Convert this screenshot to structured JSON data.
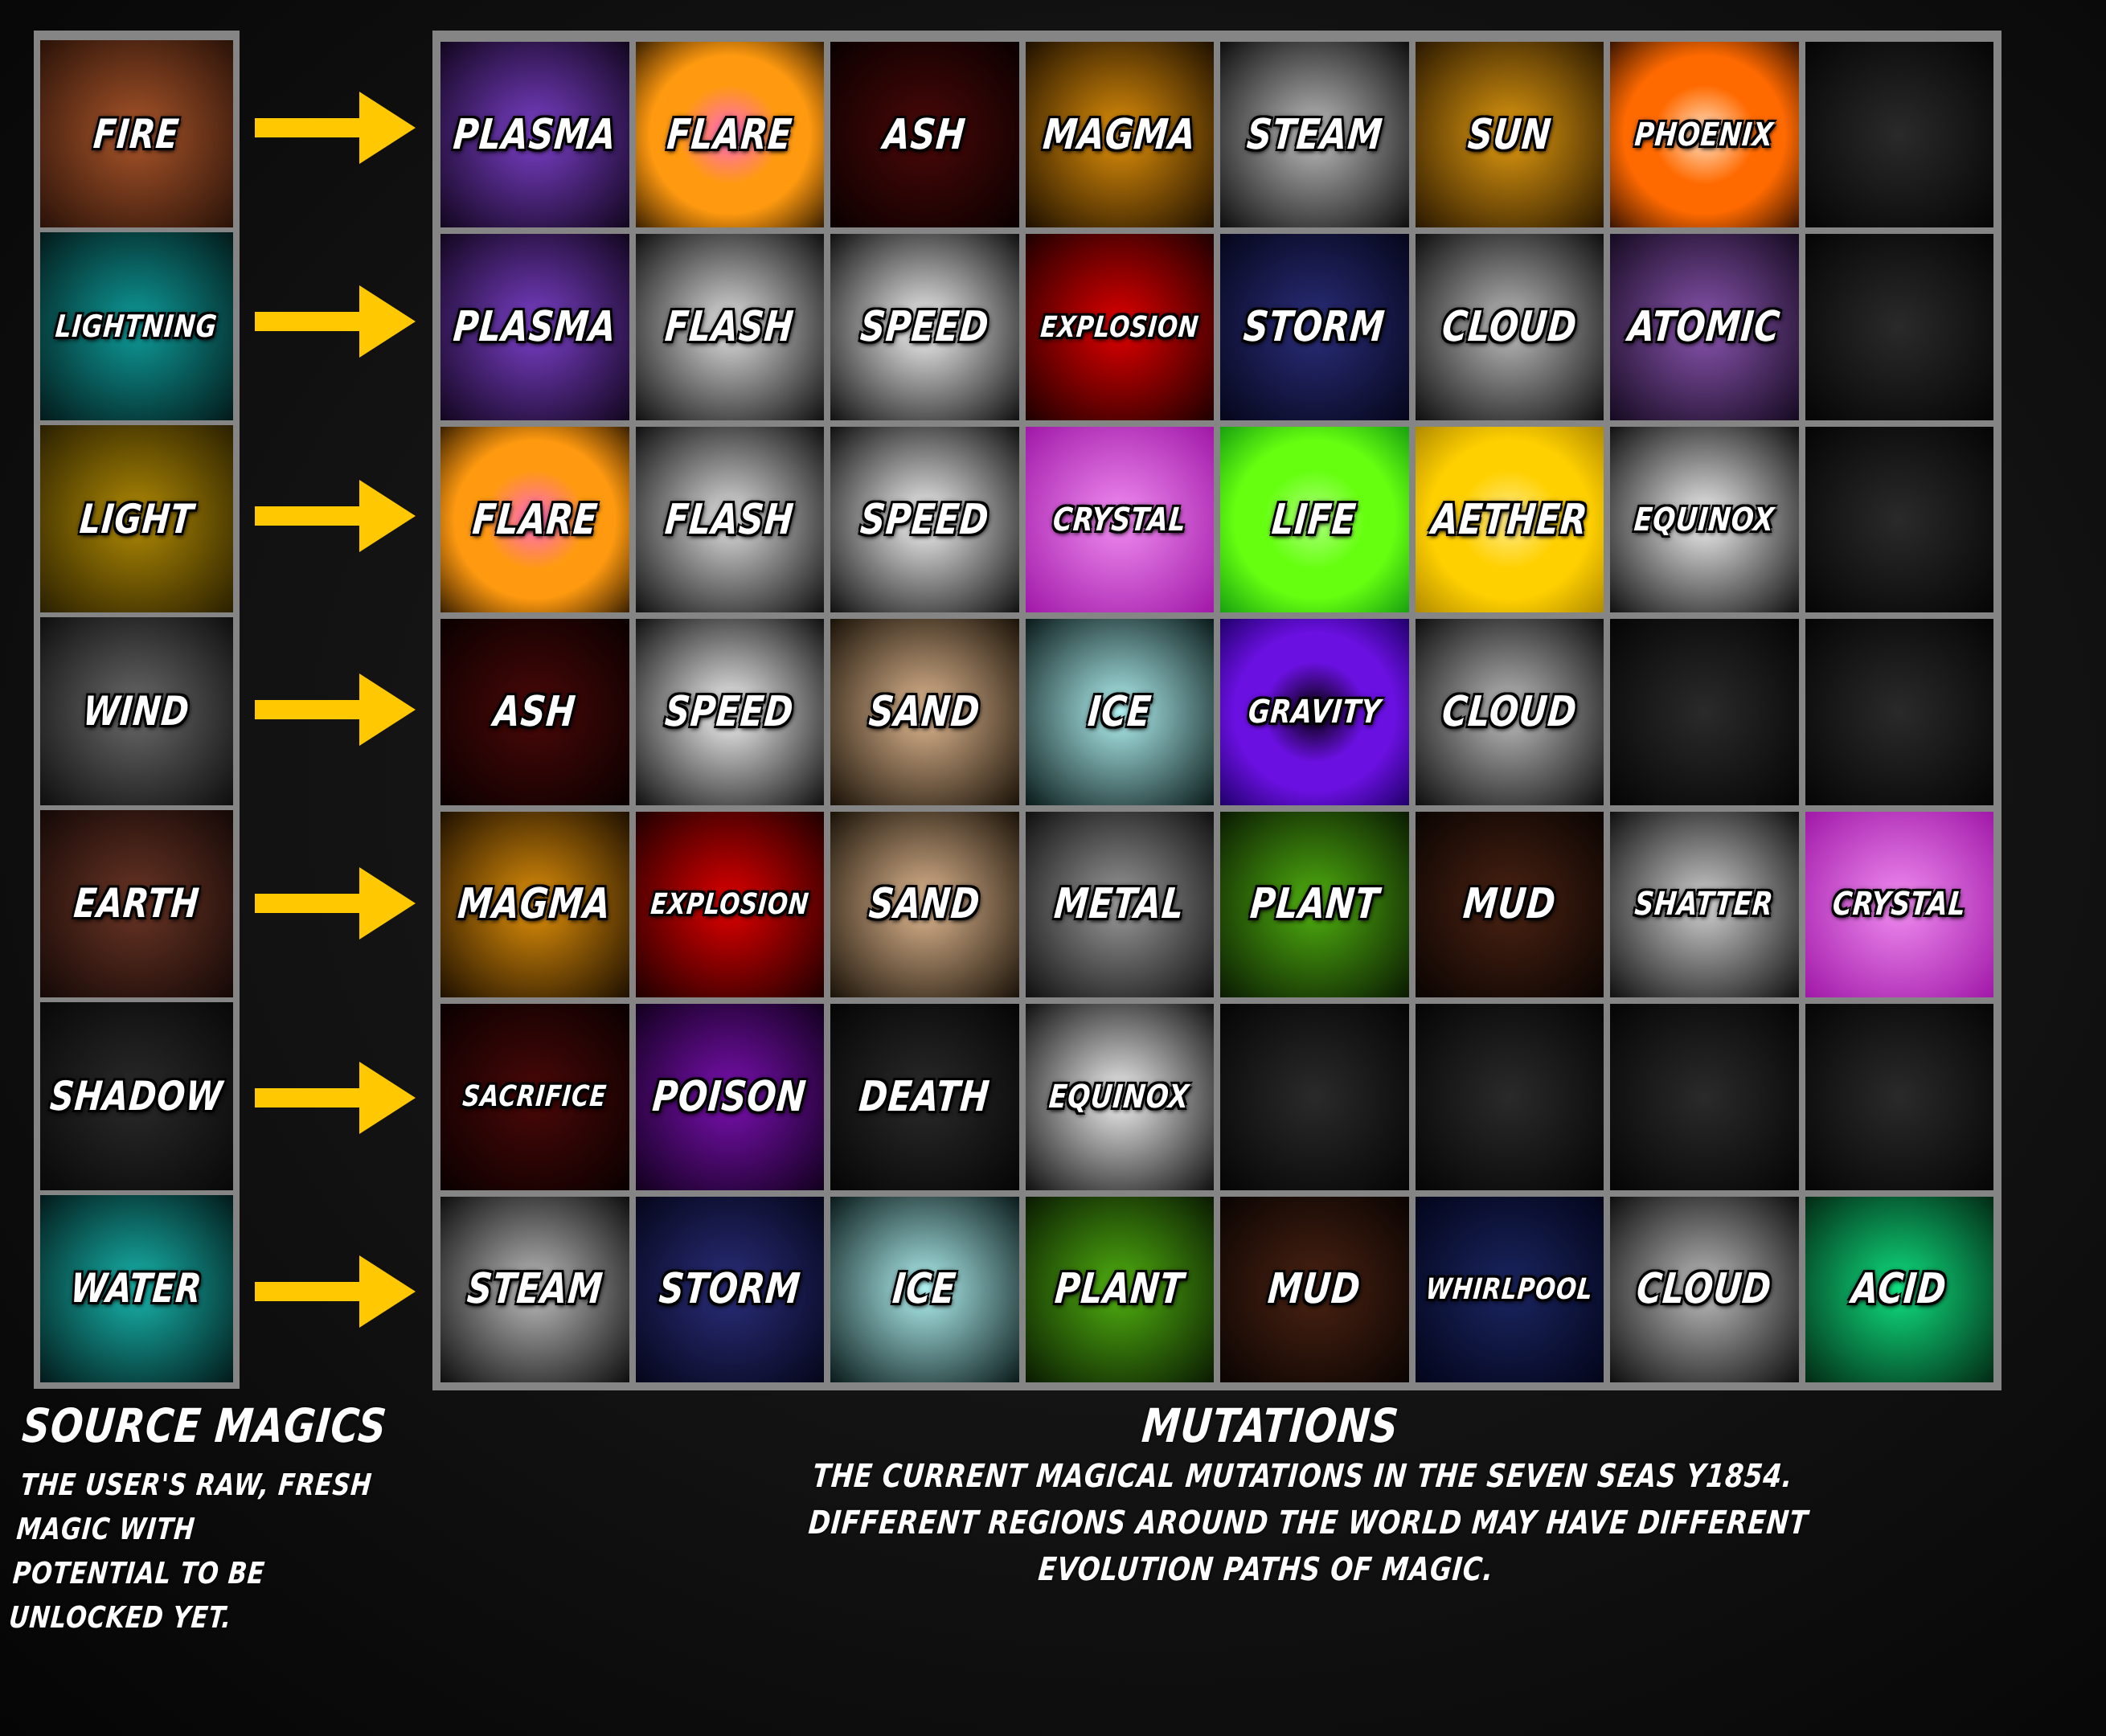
{
  "source_panel": {
    "title": "SOURCE MAGICS",
    "description": "THE USER'S RAW, FRESH MAGIC WITH POTENTIAL TO BE UNLOCKED YET.",
    "description_lines": [
      "THE USER'S RAW, FRESH",
      "MAGIC WITH",
      "POTENTIAL TO BE",
      "UNLOCKED YET."
    ],
    "sources": [
      {
        "label": "FIRE",
        "color": "#a9552a",
        "edge": "#2a1208"
      },
      {
        "label": "LIGHTNING",
        "color": "#0e9c9a",
        "edge": "#031a1a"
      },
      {
        "label": "LIGHT",
        "color": "#b08a05",
        "edge": "#2a2000"
      },
      {
        "label": "WIND",
        "color": "#6a6a6a",
        "edge": "#0e0e0e"
      },
      {
        "label": "EARTH",
        "color": "#6a3525",
        "edge": "#140806"
      },
      {
        "label": "SHADOW",
        "color": "#2a2a2a",
        "edge": "#080808"
      },
      {
        "label": "WATER",
        "color": "#18b5ac",
        "edge": "#021a1a"
      }
    ]
  },
  "arrow_color": "#ffc800",
  "mutation_panel": {
    "title": "MUTATIONS",
    "description_lines": [
      "THE CURRENT MAGICAL MUTATIONS IN THE SEVEN SEAS Y1854.",
      "DIFFERENT REGIONS AROUND THE WORLD MAY HAVE DIFFERENT",
      "EVOLUTION PATHS OF MAGIC."
    ],
    "rows": [
      {
        "source": "FIRE",
        "cells": [
          {
            "label": "PLASMA",
            "color": "#7a3fc8",
            "edge": "#12061e"
          },
          {
            "label": "FLARE",
            "color": "#ff66cc",
            "mid": "#ff9a10",
            "edge": "#3a2000"
          },
          {
            "label": "ASH",
            "color": "#4a0808",
            "edge": "#0a0000"
          },
          {
            "label": "MAGMA",
            "color": "#e0900a",
            "edge": "#1e1000"
          },
          {
            "label": "STEAM",
            "color": "#bdbdbd",
            "edge": "#0e0e0e"
          },
          {
            "label": "SUN",
            "color": "#e09a10",
            "edge": "#2a1800"
          },
          {
            "label": "PHOENIX",
            "color": "#ffe6cc",
            "mid": "#ff6a00",
            "edge": "#3a1400"
          },
          {
            "label": "",
            "color": "#2a2a2a",
            "edge": "#050505"
          }
        ]
      },
      {
        "source": "LIGHTNING",
        "cells": [
          {
            "label": "PLASMA",
            "color": "#7a3fc8",
            "edge": "#12061e"
          },
          {
            "label": "FLASH",
            "color": "#e0e0e0",
            "edge": "#101010"
          },
          {
            "label": "SPEED",
            "color": "#f4f4f4",
            "edge": "#101010"
          },
          {
            "label": "EXPLOSION",
            "color": "#e00000",
            "edge": "#1e0000"
          },
          {
            "label": "STORM",
            "color": "#2a2d7a",
            "edge": "#05061a"
          },
          {
            "label": "CLOUD",
            "color": "#bdbdbd",
            "edge": "#0e0e0e"
          },
          {
            "label": "ATOMIC",
            "color": "#8a55b0",
            "edge": "#150a20"
          },
          {
            "label": "",
            "color": "#2a2a2a",
            "edge": "#050505"
          }
        ]
      },
      {
        "source": "LIGHT",
        "cells": [
          {
            "label": "FLARE",
            "color": "#ff66cc",
            "mid": "#ff9a10",
            "edge": "#3a2000"
          },
          {
            "label": "FLASH",
            "color": "#e0e0e0",
            "edge": "#101010"
          },
          {
            "label": "SPEED",
            "color": "#f4f4f4",
            "edge": "#101010"
          },
          {
            "label": "CRYSTAL",
            "color": "#f08cf0",
            "edge": "#a018a8"
          },
          {
            "label": "LIFE",
            "color": "#b0ff80",
            "mid": "#66ff10",
            "edge": "#18a010"
          },
          {
            "label": "AETHER",
            "color": "#ffec90",
            "mid": "#ffd000",
            "edge": "#b08a00"
          },
          {
            "label": "EQUINOX",
            "color": "#f0f0f0",
            "edge": "#101010"
          },
          {
            "label": "",
            "color": "#2a2a2a",
            "edge": "#050505"
          }
        ]
      },
      {
        "source": "WIND",
        "cells": [
          {
            "label": "ASH",
            "color": "#4a0808",
            "edge": "#0a0000"
          },
          {
            "label": "SPEED",
            "color": "#f4f4f4",
            "edge": "#101010"
          },
          {
            "label": "SAND",
            "color": "#e0b890",
            "edge": "#1a1208"
          },
          {
            "label": "ICE",
            "color": "#b0f0f0",
            "edge": "#0a1a1a"
          },
          {
            "label": "GRAVITY",
            "color": "#000000",
            "mid": "#6a10e0",
            "edge": "#20006a"
          },
          {
            "label": "CLOUD",
            "color": "#bdbdbd",
            "edge": "#0e0e0e"
          },
          {
            "label": "",
            "color": "#2a2a2a",
            "edge": "#050505"
          },
          {
            "label": "",
            "color": "#2a2a2a",
            "edge": "#050505"
          }
        ]
      },
      {
        "source": "EARTH",
        "cells": [
          {
            "label": "MAGMA",
            "color": "#e0900a",
            "edge": "#1e1000"
          },
          {
            "label": "EXPLOSION",
            "color": "#e00000",
            "edge": "#1e0000"
          },
          {
            "label": "SAND",
            "color": "#e0b890",
            "edge": "#1a1208"
          },
          {
            "label": "METAL",
            "color": "#9a9a9a",
            "edge": "#101010"
          },
          {
            "label": "PLANT",
            "color": "#50b010",
            "edge": "#0a1a02"
          },
          {
            "label": "MUD",
            "color": "#4a2212",
            "edge": "#0a0402"
          },
          {
            "label": "SHATTER",
            "color": "#d0d0d0",
            "edge": "#101010"
          },
          {
            "label": "CRYSTAL",
            "color": "#f08cf0",
            "edge": "#a018a8"
          }
        ]
      },
      {
        "source": "SHADOW",
        "cells": [
          {
            "label": "SACRIFICE",
            "color": "#4a0808",
            "edge": "#0a0000"
          },
          {
            "label": "POISON",
            "color": "#7a10b0",
            "edge": "#12001e"
          },
          {
            "label": "DEATH",
            "color": "#2a2a2a",
            "edge": "#050505"
          },
          {
            "label": "EQUINOX",
            "color": "#f0f0f0",
            "edge": "#101010"
          },
          {
            "label": "",
            "color": "#2a2a2a",
            "edge": "#050505"
          },
          {
            "label": "",
            "color": "#2a2a2a",
            "edge": "#050505"
          },
          {
            "label": "",
            "color": "#2a2a2a",
            "edge": "#050505"
          },
          {
            "label": "",
            "color": "#2a2a2a",
            "edge": "#050505"
          }
        ]
      },
      {
        "source": "WATER",
        "cells": [
          {
            "label": "STEAM",
            "color": "#bdbdbd",
            "edge": "#0e0e0e"
          },
          {
            "label": "STORM",
            "color": "#2a2d7a",
            "edge": "#05061a"
          },
          {
            "label": "ICE",
            "color": "#b0f0f0",
            "edge": "#0a1a1a"
          },
          {
            "label": "PLANT",
            "color": "#50b010",
            "edge": "#0a1a02"
          },
          {
            "label": "MUD",
            "color": "#4a2212",
            "edge": "#0a0402"
          },
          {
            "label": "WHIRLPOOL",
            "color": "#1a2560",
            "edge": "#03051a"
          },
          {
            "label": "CLOUD",
            "color": "#bdbdbd",
            "edge": "#0e0e0e"
          },
          {
            "label": "ACID",
            "color": "#10e080",
            "edge": "#022a14"
          }
        ]
      }
    ]
  }
}
